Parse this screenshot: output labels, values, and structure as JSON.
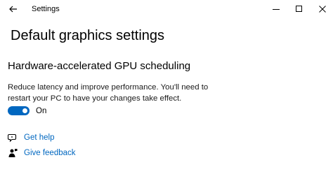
{
  "window": {
    "title": "Settings"
  },
  "page": {
    "title": "Default graphics settings"
  },
  "gpu_scheduling": {
    "heading": "Hardware-accelerated GPU scheduling",
    "description": "Reduce latency and improve performance. You'll need to restart your PC to have your changes take effect.",
    "toggle_on": true,
    "toggle_label": "On"
  },
  "links": {
    "help": "Get help",
    "feedback": "Give feedback"
  },
  "colors": {
    "accent": "#0067c0"
  },
  "icons": {
    "back": "back-arrow-icon",
    "minimize": "minimize-icon",
    "maximize": "maximize-icon",
    "close": "close-icon",
    "help": "help-chat-icon",
    "feedback": "feedback-person-icon"
  }
}
